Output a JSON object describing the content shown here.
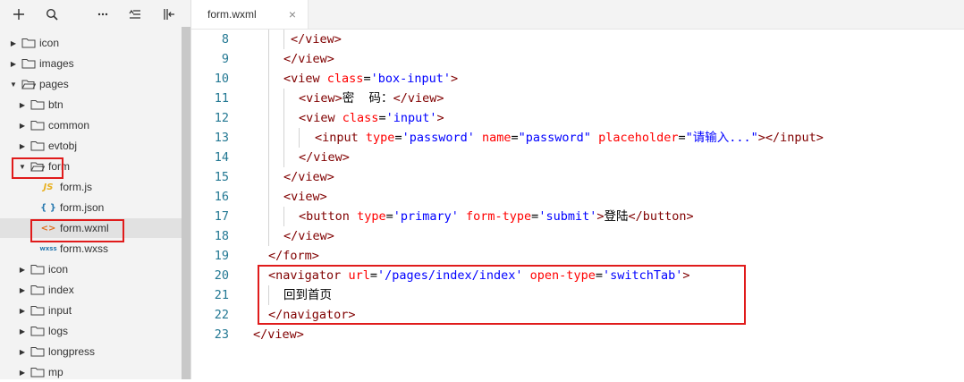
{
  "toolbar": {
    "icons": [
      "plus-icon",
      "search-icon",
      "more-icon",
      "collapse-icon",
      "split-icon"
    ]
  },
  "tree": [
    {
      "label": "icon",
      "kind": "folder",
      "state": "closed",
      "depth": 0
    },
    {
      "label": "images",
      "kind": "folder",
      "state": "closed",
      "depth": 0
    },
    {
      "label": "pages",
      "kind": "folder",
      "state": "open",
      "depth": 0
    },
    {
      "label": "btn",
      "kind": "folder",
      "state": "closed",
      "depth": 1
    },
    {
      "label": "common",
      "kind": "folder",
      "state": "closed",
      "depth": 1
    },
    {
      "label": "evtobj",
      "kind": "folder",
      "state": "closed",
      "depth": 1
    },
    {
      "label": "form",
      "kind": "folder",
      "state": "open",
      "depth": 1
    },
    {
      "label": "form.js",
      "kind": "file",
      "badge": "JS",
      "depth": 2
    },
    {
      "label": "form.json",
      "kind": "file",
      "badge": "{ }",
      "depth": 2
    },
    {
      "label": "form.wxml",
      "kind": "file",
      "badge": "<>",
      "depth": 2,
      "selected": true
    },
    {
      "label": "form.wxss",
      "kind": "file",
      "badge": "wxss",
      "depth": 2
    },
    {
      "label": "icon",
      "kind": "folder",
      "state": "closed",
      "depth": 1
    },
    {
      "label": "index",
      "kind": "folder",
      "state": "closed",
      "depth": 1
    },
    {
      "label": "input",
      "kind": "folder",
      "state": "closed",
      "depth": 1
    },
    {
      "label": "logs",
      "kind": "folder",
      "state": "closed",
      "depth": 1
    },
    {
      "label": "longpress",
      "kind": "folder",
      "state": "closed",
      "depth": 1
    },
    {
      "label": "mp",
      "kind": "folder",
      "state": "closed",
      "depth": 1
    }
  ],
  "tab": {
    "label": "form.wxml",
    "close": "×"
  },
  "code": [
    {
      "n": "8",
      "tokens": [
        [
          "br",
          "</"
        ],
        [
          "tag",
          "view"
        ],
        [
          "br",
          ">"
        ]
      ]
    },
    {
      "n": "9",
      "tokens": [
        [
          "br",
          "</"
        ],
        [
          "tag",
          "view"
        ],
        [
          "br",
          ">"
        ]
      ]
    },
    {
      "n": "10",
      "tokens": [
        [
          "br",
          "<"
        ],
        [
          "tag",
          "view"
        ],
        [
          "txt",
          " "
        ],
        [
          "att",
          "class"
        ],
        [
          "txt",
          "="
        ],
        [
          "val",
          "'box-input'"
        ],
        [
          "br",
          ">"
        ]
      ]
    },
    {
      "n": "11",
      "tokens": [
        [
          "br",
          "<"
        ],
        [
          "tag",
          "view"
        ],
        [
          "br",
          ">"
        ],
        [
          "txt",
          "密  码："
        ],
        [
          "br",
          "</"
        ],
        [
          "tag",
          "view"
        ],
        [
          "br",
          ">"
        ]
      ]
    },
    {
      "n": "12",
      "tokens": [
        [
          "br",
          "<"
        ],
        [
          "tag",
          "view"
        ],
        [
          "txt",
          " "
        ],
        [
          "att",
          "class"
        ],
        [
          "txt",
          "="
        ],
        [
          "val",
          "'input'"
        ],
        [
          "br",
          ">"
        ]
      ]
    },
    {
      "n": "13",
      "tokens": [
        [
          "br",
          "<"
        ],
        [
          "tag",
          "input"
        ],
        [
          "txt",
          " "
        ],
        [
          "att",
          "type"
        ],
        [
          "txt",
          "="
        ],
        [
          "val",
          "'password'"
        ],
        [
          "txt",
          " "
        ],
        [
          "att",
          "name"
        ],
        [
          "txt",
          "="
        ],
        [
          "val",
          "\"password\""
        ],
        [
          "txt",
          " "
        ],
        [
          "att",
          "placeholder"
        ],
        [
          "txt",
          "="
        ],
        [
          "val",
          "\"请输入...\""
        ],
        [
          "br",
          "></"
        ],
        [
          "tag",
          "input"
        ],
        [
          "br",
          ">"
        ]
      ]
    },
    {
      "n": "14",
      "tokens": [
        [
          "br",
          "</"
        ],
        [
          "tag",
          "view"
        ],
        [
          "br",
          ">"
        ]
      ]
    },
    {
      "n": "15",
      "tokens": [
        [
          "br",
          "</"
        ],
        [
          "tag",
          "view"
        ],
        [
          "br",
          ">"
        ]
      ]
    },
    {
      "n": "16",
      "tokens": [
        [
          "br",
          "<"
        ],
        [
          "tag",
          "view"
        ],
        [
          "br",
          ">"
        ]
      ]
    },
    {
      "n": "17",
      "tokens": [
        [
          "br",
          "<"
        ],
        [
          "tag",
          "button"
        ],
        [
          "txt",
          " "
        ],
        [
          "att",
          "type"
        ],
        [
          "txt",
          "="
        ],
        [
          "val",
          "'primary'"
        ],
        [
          "txt",
          " "
        ],
        [
          "att",
          "form-type"
        ],
        [
          "txt",
          "="
        ],
        [
          "val",
          "'submit'"
        ],
        [
          "br",
          ">"
        ],
        [
          "txt",
          "登陆"
        ],
        [
          "br",
          "</"
        ],
        [
          "tag",
          "button"
        ],
        [
          "br",
          ">"
        ]
      ]
    },
    {
      "n": "18",
      "tokens": [
        [
          "br",
          "</"
        ],
        [
          "tag",
          "view"
        ],
        [
          "br",
          ">"
        ]
      ]
    },
    {
      "n": "19",
      "tokens": [
        [
          "br",
          "</"
        ],
        [
          "tag",
          "form"
        ],
        [
          "br",
          ">"
        ]
      ]
    },
    {
      "n": "20",
      "tokens": [
        [
          "br",
          "<"
        ],
        [
          "tag",
          "navigator"
        ],
        [
          "txt",
          " "
        ],
        [
          "att",
          "url"
        ],
        [
          "txt",
          "="
        ],
        [
          "val",
          "'/pages/index/index'"
        ],
        [
          "txt",
          " "
        ],
        [
          "att",
          "open-type"
        ],
        [
          "txt",
          "="
        ],
        [
          "val",
          "'switchTab'"
        ],
        [
          "br",
          ">"
        ]
      ]
    },
    {
      "n": "21",
      "tokens": [
        [
          "txt",
          "回到首页"
        ]
      ]
    },
    {
      "n": "22",
      "tokens": [
        [
          "br",
          "</"
        ],
        [
          "tag",
          "navigator"
        ],
        [
          "br",
          ">"
        ]
      ]
    },
    {
      "n": "23",
      "tokens": [
        [
          "br",
          "</"
        ],
        [
          "tag",
          "view"
        ],
        [
          "br",
          ">"
        ]
      ]
    }
  ],
  "colors": {
    "highlight_box": "#e01b1b",
    "line_numbers": "#237893",
    "tag": "#800000",
    "attribute": "#ff0000",
    "value": "#0000ff"
  }
}
